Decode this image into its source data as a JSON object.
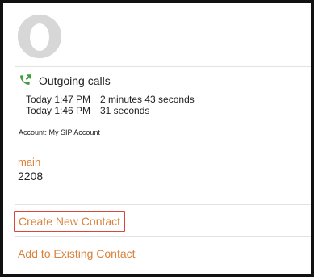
{
  "avatar": {
    "icon": "person-silhouette-icon"
  },
  "calls": {
    "icon": "outgoing-call-icon",
    "icon_color": "#3b9c3b",
    "title": "Outgoing calls",
    "entries": [
      {
        "time": "Today 1:47 PM",
        "duration": "2 minutes 43 seconds"
      },
      {
        "time": "Today 1:46 PM",
        "duration": "31 seconds"
      }
    ]
  },
  "account": {
    "text": "Account: My SIP Account"
  },
  "phone": {
    "label": "main",
    "number": "2208"
  },
  "actions": {
    "create_new_contact": "Create New Contact",
    "add_to_existing_contact": "Add to Existing Contact"
  },
  "colors": {
    "accent": "#d9823b",
    "highlight_border": "#d9463f",
    "divider": "#e3e3e3"
  }
}
